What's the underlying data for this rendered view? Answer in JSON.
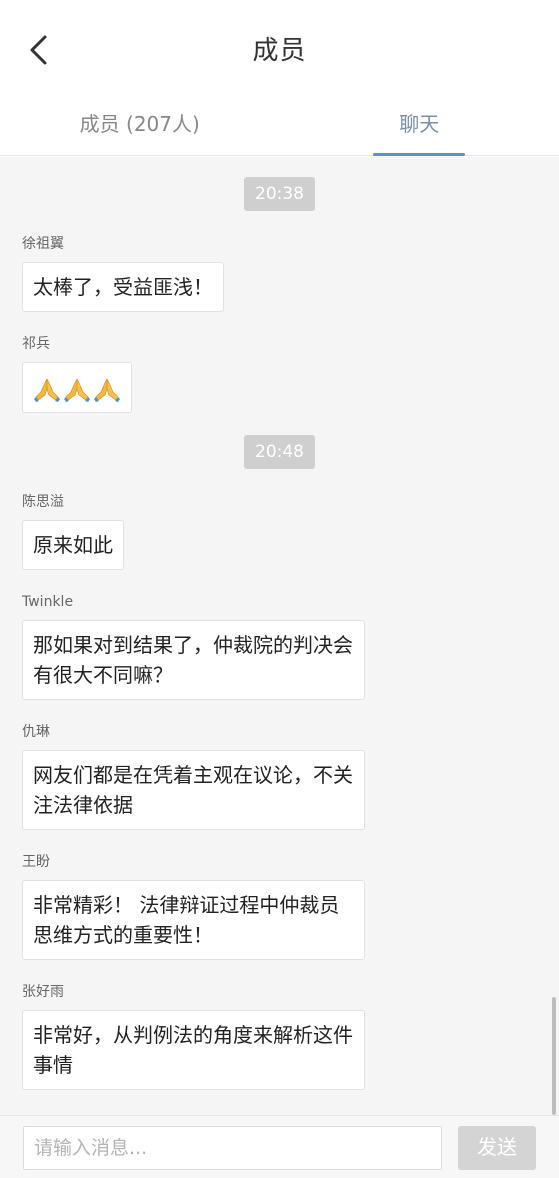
{
  "header": {
    "title": "成员",
    "back_icon": "chevron-left-icon"
  },
  "tabs": [
    {
      "label": "成员 (207人)",
      "active": false
    },
    {
      "label": "聊天",
      "active": true
    }
  ],
  "chat": {
    "groups": [
      {
        "time": "20:38",
        "messages": [
          {
            "sender": "徐祖翼",
            "text": "太棒了，受益匪浅！"
          },
          {
            "sender": "祁兵",
            "text": "🙏🙏🙏"
          }
        ]
      },
      {
        "time": "20:48",
        "messages": [
          {
            "sender": "陈思溢",
            "text": "原来如此"
          },
          {
            "sender": "Twinkle",
            "text": "那如果对到结果了，仲裁院的判决会有很大不同嘛？"
          },
          {
            "sender": "仇琳",
            "text": "网友们都是在凭着主观在议论，不关注法律依据"
          },
          {
            "sender": "王盼",
            "text": "非常精彩！ 法律辩证过程中仲裁员思维方式的重要性！"
          },
          {
            "sender": "张好雨",
            "text": "非常好，从判例法的角度来解析这件事情"
          }
        ]
      }
    ]
  },
  "input": {
    "placeholder": "请输入消息...",
    "value": "",
    "send_label": "发送"
  },
  "colors": {
    "tab_active_underline": "#5b8fd8",
    "timestamp_bg": "#cfcfcf",
    "chat_bg": "#f5f5f5",
    "send_button_disabled": "#d4d4d4"
  }
}
